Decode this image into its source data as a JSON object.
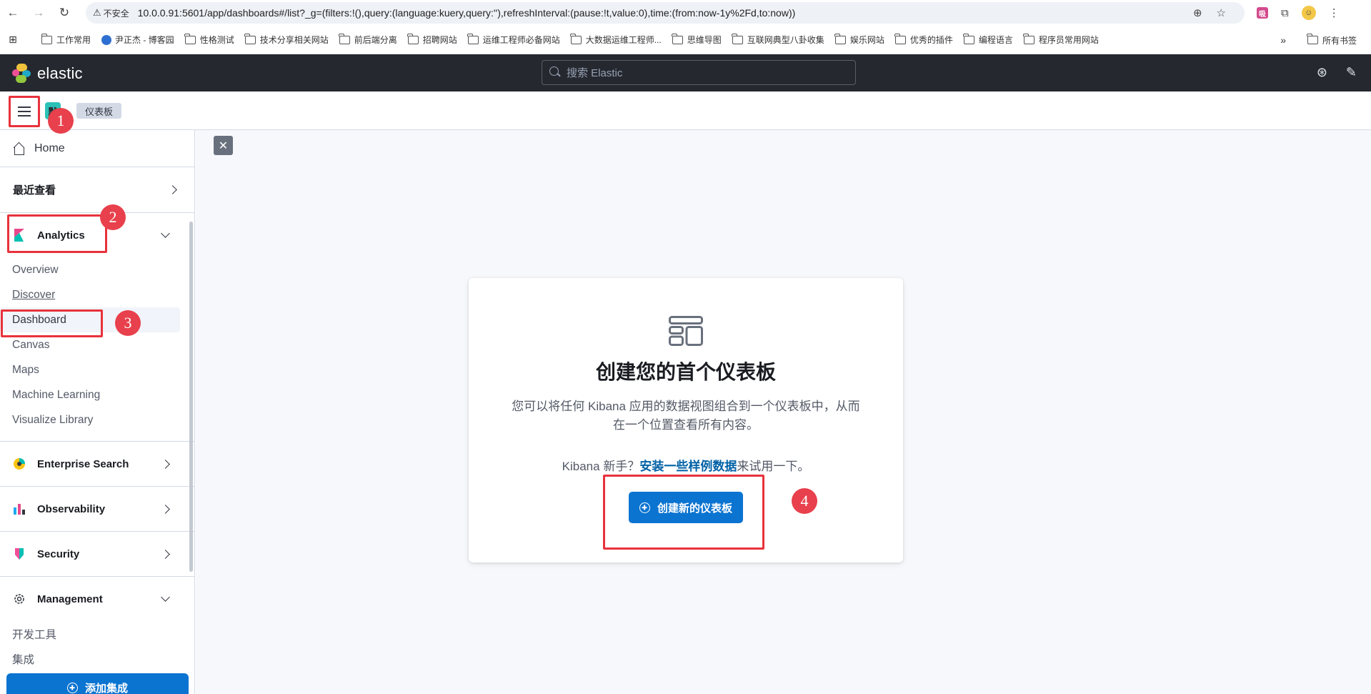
{
  "browser": {
    "security_label": "不安全",
    "url": "10.0.0.91:5601/app/dashboards#/list?_g=(filters:!(),query:(language:kuery,query:''),refreshInterval:(pause:!t,value:0),time:(from:now-1y%2Fd,to:now))",
    "bookmarks": [
      "工作常用",
      "尹正杰 - 博客园",
      "性格测试",
      "技术分享相关网站",
      "前后端分离",
      "招聘网站",
      "运维工程师必备网站",
      "大数据运维工程师...",
      "思维导图",
      "互联网典型八卦收集",
      "娱乐网站",
      "优秀的插件",
      "编程语言",
      "程序员常用网站"
    ],
    "bookmarks_more": "»",
    "all_bookmarks": "所有书签",
    "ext_pink_label": "吸"
  },
  "header": {
    "brand": "elastic",
    "search_placeholder": "搜索 Elastic"
  },
  "breadcrumb": {
    "space_initial": "默",
    "current": "仪表板"
  },
  "badges": [
    "1",
    "2",
    "3",
    "4"
  ],
  "sidebar": {
    "home": "Home",
    "recent": "最近查看",
    "analytics": {
      "label": "Analytics",
      "items": [
        "Overview",
        "Discover",
        "Dashboard",
        "Canvas",
        "Maps",
        "Machine Learning",
        "Visualize Library"
      ]
    },
    "enterprise_search": "Enterprise Search",
    "observability": "Observability",
    "security": "Security",
    "management": {
      "label": "Management",
      "items": [
        "开发工具",
        "集成"
      ]
    },
    "add_integration": "添加集成"
  },
  "empty_state": {
    "title": "创建您的首个仪表板",
    "body": "您可以将任何 Kibana 应用的数据视图组合到一个仪表板中，从而在一个位置查看所有内容。",
    "hint_prefix": "Kibana 新手？",
    "hint_link": "安装一些样例数据",
    "hint_suffix": "来试用一下。",
    "create_button": "创建新的仪表板"
  },
  "colors": {
    "header_bg": "#25282f",
    "primary": "#0b74d1",
    "annotation_red": "#e8323c"
  }
}
